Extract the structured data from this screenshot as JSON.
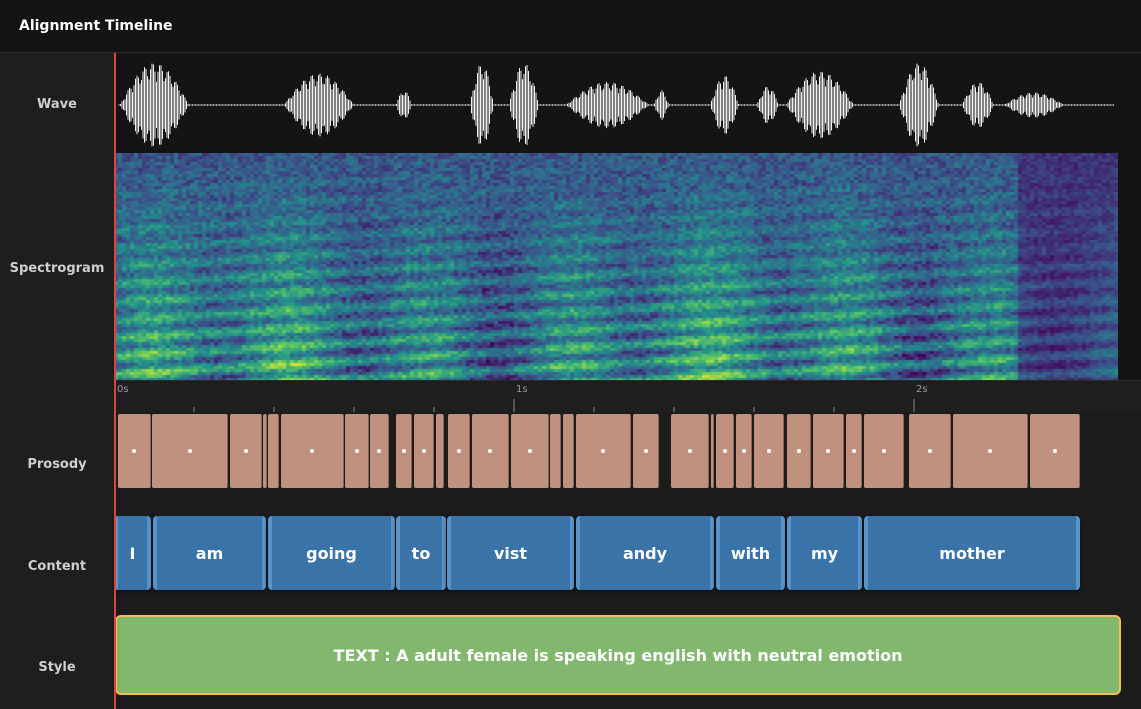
{
  "window": {
    "title": "Alignment Timeline"
  },
  "tracks": {
    "wave": "Wave",
    "spectrogram": "Spectrogram",
    "prosody": "Prosody",
    "content": "Content",
    "style": "Style"
  },
  "ruler": {
    "ticks": [
      "0s",
      "1s",
      "2s"
    ]
  },
  "content_words": [
    "I",
    "am",
    "going",
    "to",
    "vist",
    "andy",
    "with",
    "my",
    "mother"
  ],
  "style": {
    "text": "TEXT : A adult female is speaking english with neutral emotion"
  },
  "colors": {
    "prosody_block": "#c0917f",
    "content_block": "#3a73a8",
    "style_block": "#81b86d",
    "style_border": "#f0c050",
    "playhead": "#e2423d"
  }
}
